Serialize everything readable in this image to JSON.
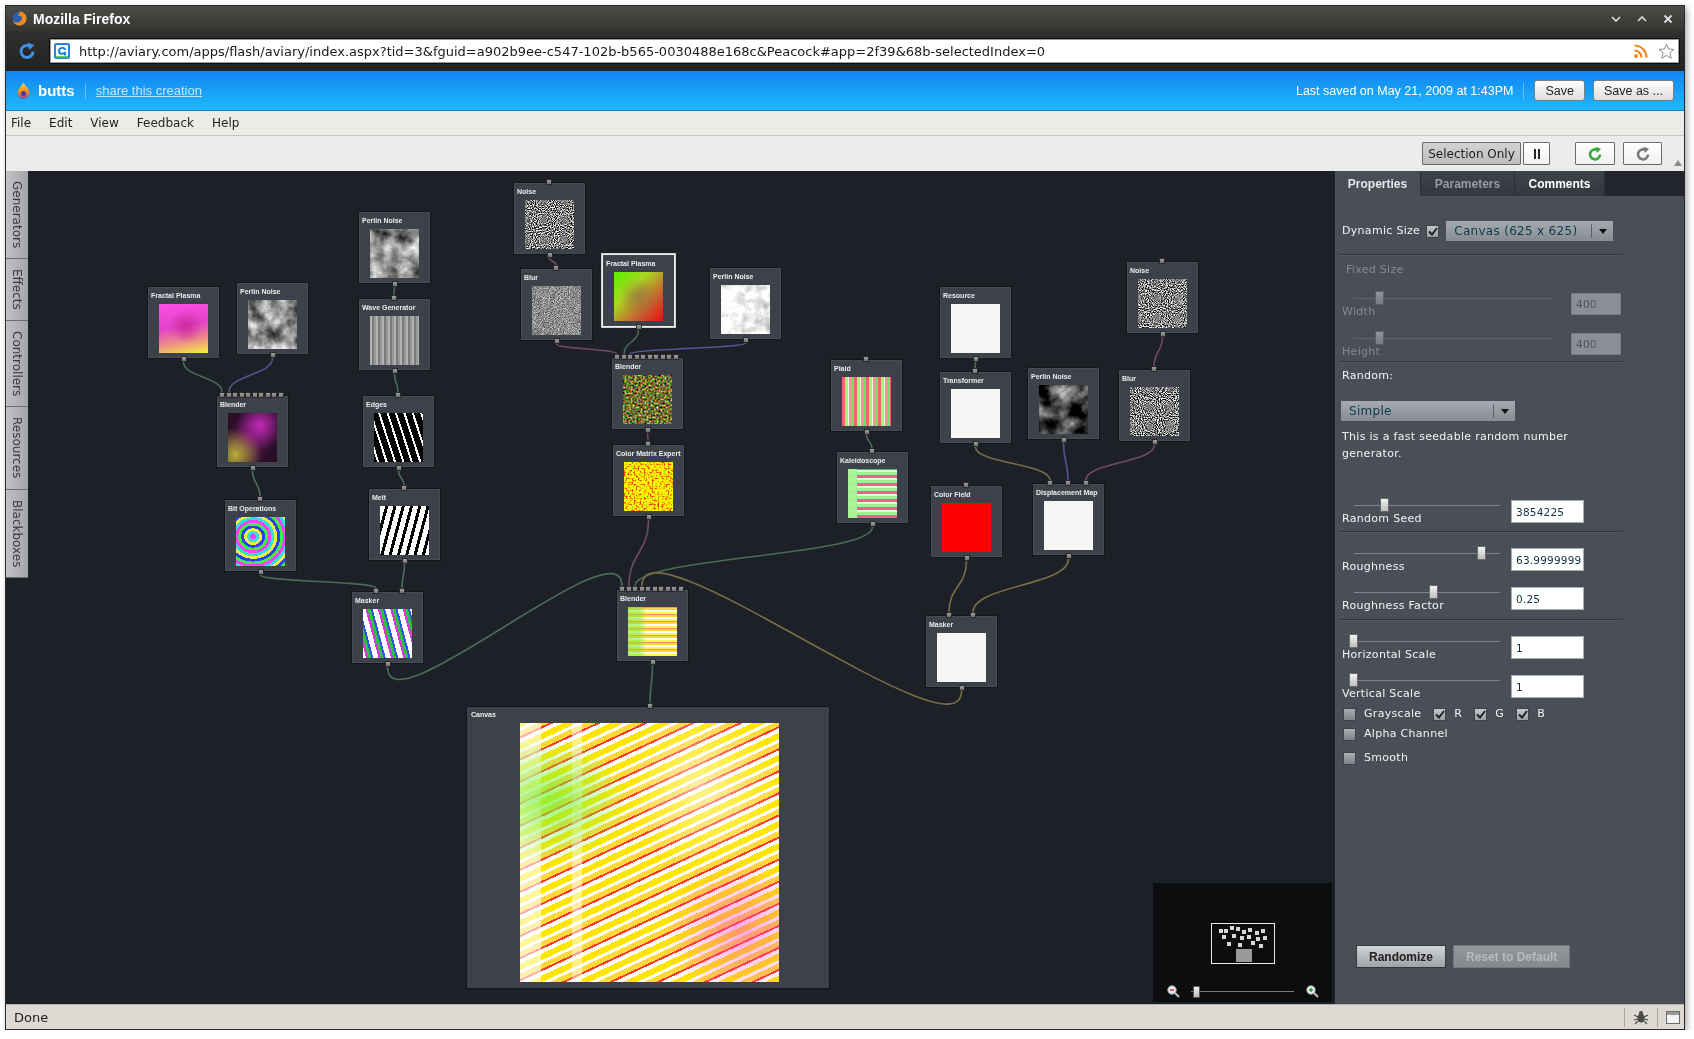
{
  "window": {
    "title": "Mozilla Firefox"
  },
  "address_bar": {
    "url": "http://aviary.com/apps/flash/aviary/index.aspx?tid=3&fguid=a902b9ee-c547-102b-b565-0030488e168c&Peacock#app=2f39&68b-selectedIndex=0"
  },
  "app_header": {
    "title": "butts",
    "share_link": "share this creation",
    "last_saved": "Last saved on May 21, 2009 at 1:43PM",
    "buttons": [
      "Save",
      "Save as ..."
    ]
  },
  "menu": [
    "File",
    "Edit",
    "View",
    "Feedback",
    "Help"
  ],
  "toolbar": {
    "selection_only": {
      "label": "Selection Only",
      "selected": true
    }
  },
  "side_tabs": [
    "Generators",
    "Effects",
    "Controllers",
    "Resources",
    "Blackboxes"
  ],
  "nodes": [
    {
      "title": "Fractal Plasma",
      "kind": "plasma",
      "selected": false
    },
    {
      "title": "Perlin Noise",
      "kind": "clouds",
      "selected": false
    },
    {
      "title": "Perlin Noise",
      "kind": "clouds",
      "selected": false
    },
    {
      "title": "Wave Generator",
      "kind": "waves",
      "selected": false
    },
    {
      "title": "Blender",
      "kind": "murky",
      "selected": false
    },
    {
      "title": "Edges",
      "kind": "zigzag",
      "selected": false
    },
    {
      "title": "Bit Operations",
      "kind": "swirl",
      "selected": false
    },
    {
      "title": "Melt",
      "kind": "bands",
      "selected": false
    },
    {
      "title": "Masker",
      "kind": "psychedelic",
      "selected": false
    },
    {
      "title": "Noise",
      "kind": "noise",
      "selected": false
    },
    {
      "title": "Blur",
      "kind": "grain",
      "selected": false
    },
    {
      "title": "Fractal Plasma",
      "kind": "gradient",
      "selected": true
    },
    {
      "title": "Perlin Noise",
      "kind": "mist",
      "selected": false
    },
    {
      "title": "Blender",
      "kind": "speckle",
      "selected": false
    },
    {
      "title": "Color Matrix Expert",
      "kind": "fire",
      "selected": false
    },
    {
      "title": "Blender",
      "kind": "stripes",
      "selected": false
    },
    {
      "title": "Plaid",
      "kind": "plaid",
      "selected": false
    },
    {
      "title": "Kaleidoscope",
      "kind": "kaleido",
      "selected": false
    },
    {
      "title": "Resource",
      "kind": "blank",
      "selected": false
    },
    {
      "title": "Transformer",
      "kind": "blank",
      "selected": false
    },
    {
      "title": "Noise",
      "kind": "noise",
      "selected": false
    },
    {
      "title": "Perlin Noise",
      "kind": "dark",
      "selected": false
    },
    {
      "title": "Blur",
      "kind": "noise",
      "selected": false
    },
    {
      "title": "Color Field",
      "kind": "solid",
      "selected": false
    },
    {
      "title": "Displacement Map",
      "kind": "blank",
      "selected": false
    },
    {
      "title": "Masker",
      "kind": "blank",
      "selected": false
    }
  ],
  "canvas_node": {
    "title": "Canvas"
  },
  "navigator": {
    "zoom": {
      "level": 0.05
    }
  },
  "properties": {
    "tabs": [
      {
        "label": "Properties",
        "selected": true,
        "disabled": false
      },
      {
        "label": "Parameters",
        "selected": false,
        "disabled": true
      },
      {
        "label": "Comments",
        "selected": false,
        "disabled": false
      }
    ],
    "dynamic_size": {
      "label": "Dynamic Size",
      "checked": true,
      "dropdown": "Canvas (625 x 625)"
    },
    "fixed_size": {
      "label": "Fixed Size",
      "disabled": true,
      "sliders": [
        {
          "label": "Width",
          "level": 0.13,
          "value": "400"
        },
        {
          "label": "Height",
          "level": 0.13,
          "value": "400"
        }
      ]
    },
    "random": {
      "label": "Random:",
      "dropdown": "Simple",
      "description": "This is a fast seedable random number generator."
    },
    "slider_groups": [
      {
        "sliders": [
          {
            "label": "Random Seed",
            "level": 0.21,
            "value": "3854225"
          }
        ]
      },
      {
        "sliders": [
          {
            "label": "Roughness",
            "level": 0.88,
            "value": "63.9999999"
          },
          {
            "label": "Roughness Factor",
            "level": 0.55,
            "value": "0.25"
          }
        ]
      },
      {
        "sliders": [
          {
            "label": "Horizontal Scale",
            "level": 0,
            "value": "1"
          },
          {
            "label": "Vertical Scale",
            "level": 0,
            "value": "1"
          }
        ]
      }
    ],
    "option_rows": [
      [
        {
          "label": "Grayscale",
          "checked": false
        },
        {
          "label": "R",
          "checked": true
        },
        {
          "label": "G",
          "checked": true
        },
        {
          "label": "B",
          "checked": true
        }
      ],
      [
        {
          "label": "Alpha Channel",
          "checked": false
        }
      ],
      [
        {
          "label": "Smooth",
          "checked": false
        }
      ]
    ],
    "buttons": [
      {
        "label": "Randomize",
        "disabled": false
      },
      {
        "label": "Reset to Default",
        "disabled": true
      }
    ]
  },
  "status_bar": {
    "text": "Done"
  }
}
